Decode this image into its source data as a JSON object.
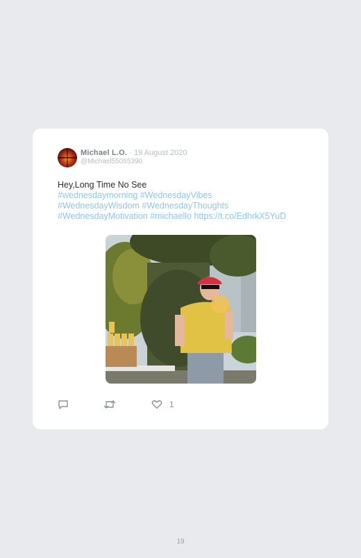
{
  "tweet": {
    "author_name": "Michael L.O.",
    "date": "· 19 August 2020",
    "handle": "@Michael55055390",
    "text_plain": "Hey,Long Time No See",
    "hashtags_line1": [
      "#wednesdaymorning",
      "#WednesdayVibes"
    ],
    "hashtags_line2": [
      "#WednesdayWisdom",
      "#WednesdayThoughts"
    ],
    "hashtags_line3": [
      "#WednesdayMotivation",
      "#michaello"
    ],
    "link": "https://t.co/EdhrkX5YuD",
    "like_count": "1"
  },
  "icons": {
    "reply": "comment-icon",
    "retweet": "retweet-icon",
    "like": "heart-icon"
  },
  "page": {
    "number": "19"
  },
  "colors": {
    "background": "#e9eaee",
    "card": "#ffffff",
    "link": "#8fc6e8",
    "muted": "#b8bcc3"
  }
}
